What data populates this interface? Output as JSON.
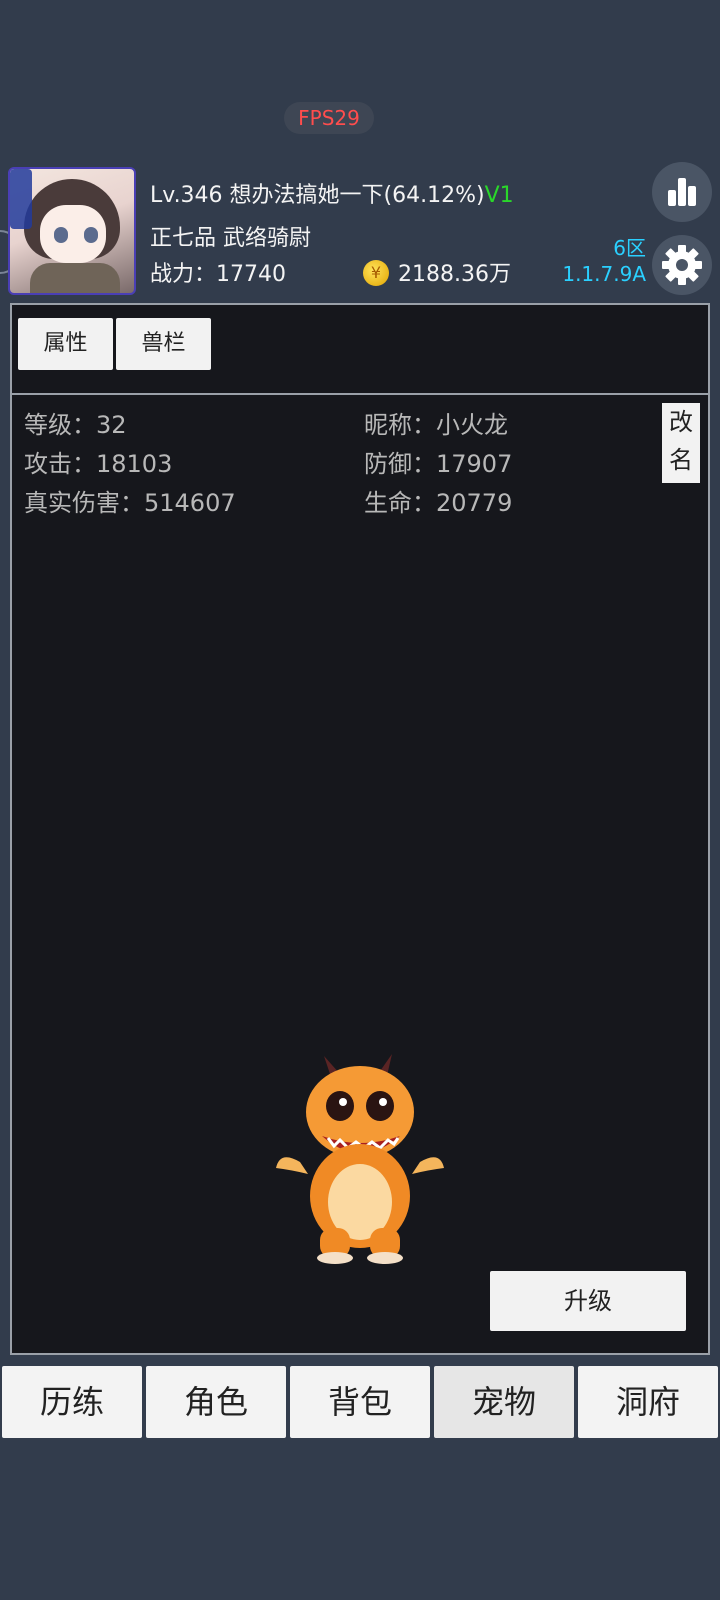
{
  "fps": "FPS29",
  "player": {
    "level_text": "Lv.346 想办法搞她一下(64.12%)",
    "vip": "V1",
    "rank": "正七品 武络骑尉",
    "power_label": "战力：",
    "power_value": "17740",
    "gold": "2188.36万",
    "zone": "6区",
    "version": "1.1.7.9A"
  },
  "tabs": [
    {
      "label": "属性"
    },
    {
      "label": "兽栏"
    }
  ],
  "pet": {
    "level": "等级：32",
    "nickname": "昵称：小火龙",
    "attack": "攻击：18103",
    "defense": "防御：17907",
    "true_damage": "真实伤害：514607",
    "hp": "生命：20779",
    "rename_line1": "改",
    "rename_line2": "名",
    "upgrade_label": "升级"
  },
  "nav": [
    {
      "label": "历练"
    },
    {
      "label": "角色"
    },
    {
      "label": "背包"
    },
    {
      "label": "宠物"
    },
    {
      "label": "洞府"
    }
  ],
  "colors": {
    "background": "#323c4c",
    "panel": "#16171c",
    "vip": "#2ad72a",
    "version": "#2ad0ff",
    "fps": "#ff4d4d"
  },
  "icons": {
    "rank": "bar-chart-icon",
    "settings": "gear-icon",
    "currency": "gold-coin-icon"
  }
}
